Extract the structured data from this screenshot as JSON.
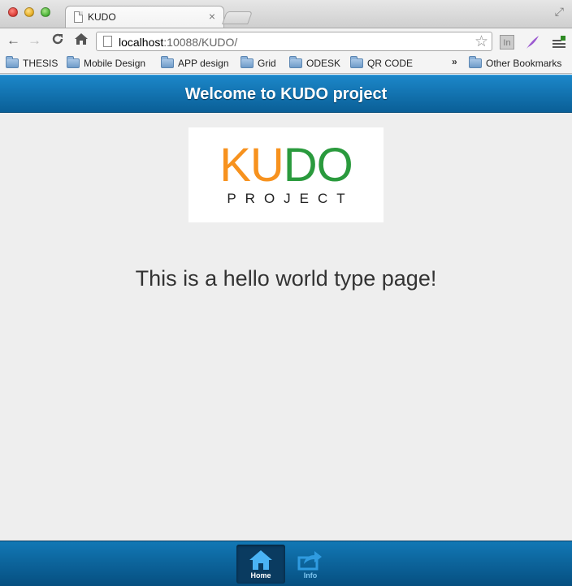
{
  "browser": {
    "tab_title": "KUDO",
    "tab_close": "×",
    "url_host": "localhost",
    "url_rest": ":10088/KUDO/",
    "nav": {
      "back": "←",
      "forward": "→",
      "reload": "C",
      "home": "⌂"
    },
    "star": "☆",
    "ext_in": "In",
    "bookmarks": [
      "THESIS",
      "Mobile Design",
      "APP design",
      "Grid",
      "ODESK",
      "QR CODE"
    ],
    "bookmarks_overflow": "»",
    "other_bookmarks": "Other Bookmarks"
  },
  "header": {
    "title": "Welcome to KUDO project"
  },
  "logo": {
    "ku": "KU",
    "do": "DO",
    "project": "PROJECT",
    "colors": {
      "ku": "#f7921e",
      "do": "#2a9a3d"
    }
  },
  "main": {
    "message": "This is a hello world type page!"
  },
  "footer": {
    "tabs": [
      {
        "label": "Home",
        "icon": "home-icon",
        "active": true
      },
      {
        "label": "Info",
        "icon": "share-icon",
        "active": false
      }
    ]
  }
}
